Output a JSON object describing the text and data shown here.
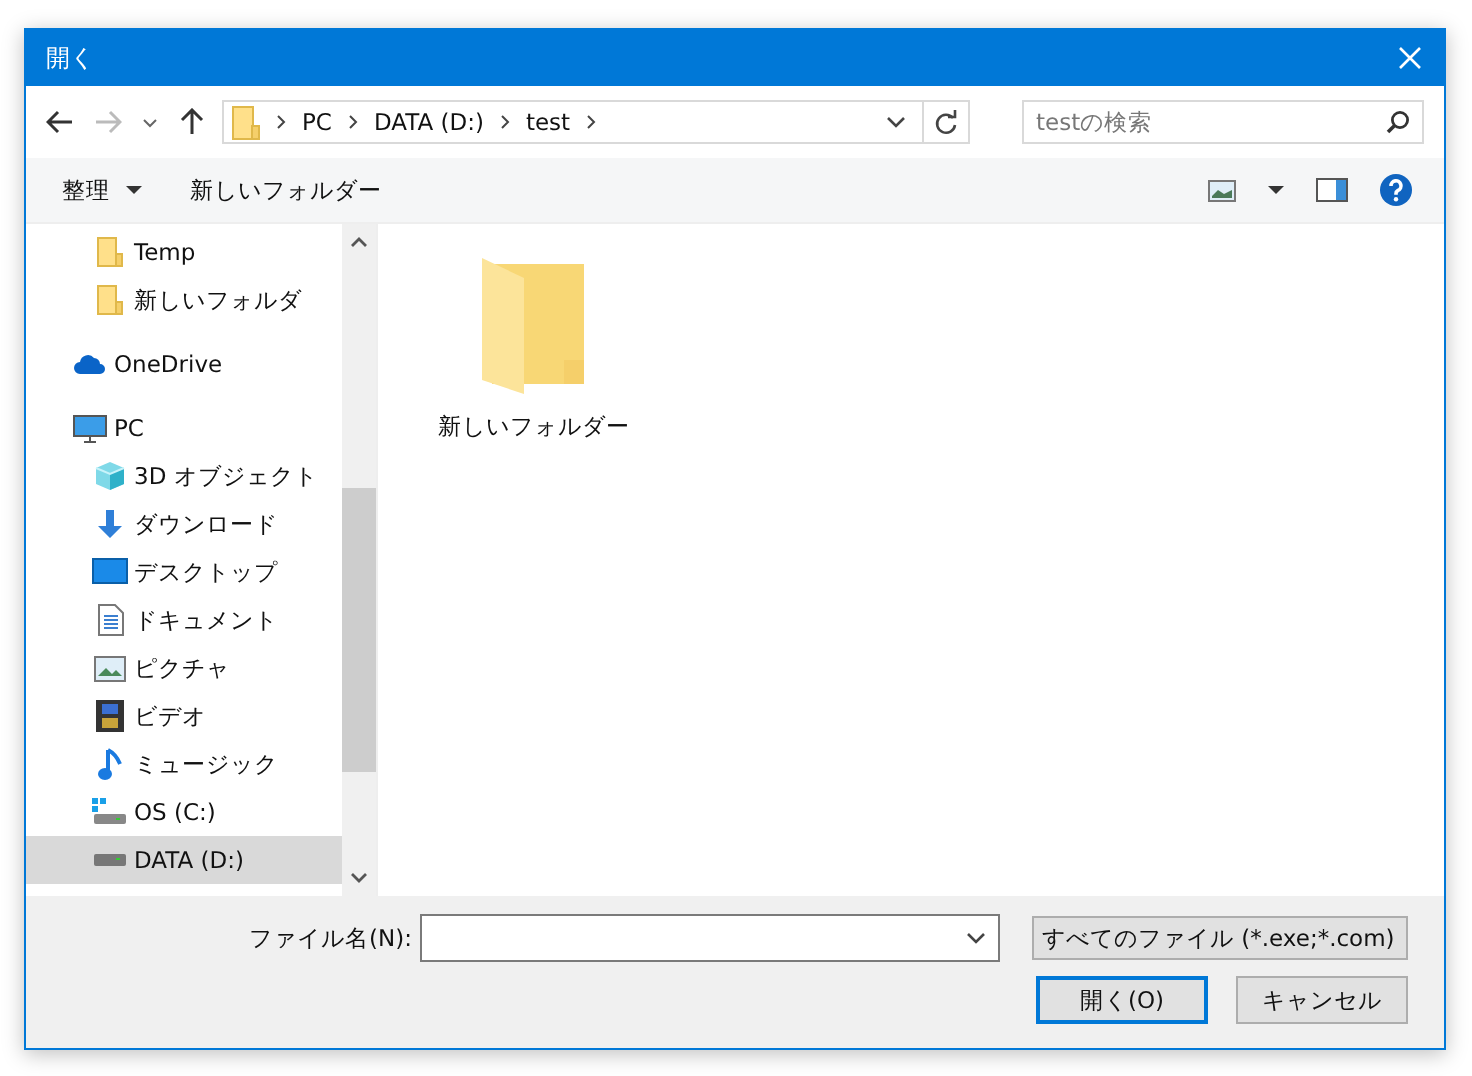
{
  "window": {
    "title": "開く"
  },
  "address": {
    "path": [
      "PC",
      "DATA (D:)",
      "test"
    ]
  },
  "search": {
    "placeholder": "testの検索"
  },
  "toolbar": {
    "organize": "整理",
    "new_folder": "新しいフォルダー"
  },
  "nav": {
    "scrolled_children": [
      {
        "label": "Temp",
        "kind": "folder",
        "selected": false
      },
      {
        "label": "新しいフォルダ",
        "kind": "folder",
        "selected": false
      }
    ],
    "items": [
      {
        "label": "OneDrive",
        "kind": "cloud",
        "selected": false
      },
      {
        "label": "PC",
        "kind": "pc",
        "selected": false,
        "children": [
          {
            "label": "3D オブジェクト",
            "kind": "cube",
            "selected": false
          },
          {
            "label": "ダウンロード",
            "kind": "download",
            "selected": false
          },
          {
            "label": "デスクトップ",
            "kind": "desktop",
            "selected": false
          },
          {
            "label": "ドキュメント",
            "kind": "document",
            "selected": false
          },
          {
            "label": "ピクチャ",
            "kind": "picture",
            "selected": false
          },
          {
            "label": "ビデオ",
            "kind": "video",
            "selected": false
          },
          {
            "label": "ミュージック",
            "kind": "music",
            "selected": false
          },
          {
            "label": "OS (C:)",
            "kind": "osdrive",
            "selected": false
          },
          {
            "label": "DATA (D:)",
            "kind": "drive",
            "selected": true
          }
        ]
      }
    ]
  },
  "files": [
    {
      "name": "新しいフォルダー",
      "kind": "folder"
    }
  ],
  "footer": {
    "filename_label": "ファイル名(N):",
    "filter": "すべてのファイル (*.exe;*.com)",
    "open": "開く(O)",
    "cancel": "キャンセル"
  }
}
